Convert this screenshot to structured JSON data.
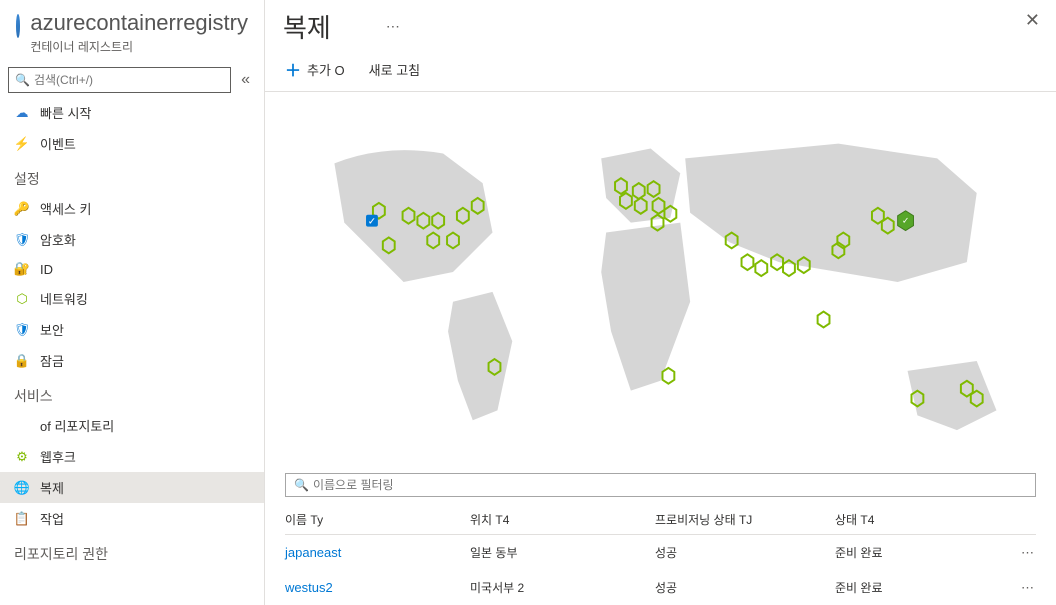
{
  "header": {
    "registry_name": "azurecontainerregistry",
    "separator": " | ",
    "page_title": "복제",
    "subtitle": "컨테이너 레지스트리"
  },
  "sidebar": {
    "search_placeholder": "검색(Ctrl+/)",
    "items": [
      {
        "label": "빠른 시작",
        "icon": "📘",
        "color": "#2f7cd0"
      },
      {
        "label": "이벤트",
        "icon": "⚡",
        "color": "#f2c811"
      }
    ],
    "section_settings": "설정",
    "settings_items": [
      {
        "label": "액세스 키",
        "icon": "🔑",
        "color": "#e8a33d"
      },
      {
        "label": "암호화",
        "icon": "🛡️",
        "color": "#0078d4"
      },
      {
        "label": "ID",
        "icon": "🔐",
        "color": "#e8a33d"
      },
      {
        "label": "네트워킹",
        "icon": "🌐",
        "color": "#7fba00"
      },
      {
        "label": "보안",
        "icon": "🛡️",
        "color": "#0078d4"
      },
      {
        "label": "잠금",
        "icon": "🔒",
        "color": "#0078d4"
      }
    ],
    "section_services": "서비스",
    "service_items": [
      {
        "label": "of 리포지토리",
        "icon": "",
        "color": ""
      },
      {
        "label": "웹후크",
        "icon": "⚙️",
        "color": "#7fba00"
      },
      {
        "label": "복제",
        "icon": "🌍",
        "color": "#0078d4",
        "selected": true
      },
      {
        "label": "작업",
        "icon": "📋",
        "color": "#e8a33d"
      }
    ],
    "section_repo_perm": "리포지토리 권한"
  },
  "toolbar": {
    "add_label": "추가 O",
    "refresh_label": "새로 고침"
  },
  "filter": {
    "placeholder": "이름으로 필터링"
  },
  "table": {
    "columns": {
      "name": "이름 Ty",
      "location": "위치 T4",
      "provisioning": "프로비저닝 상태 TJ",
      "status": "상태 T4"
    },
    "rows": [
      {
        "name": "japaneast",
        "location": "일본 동부",
        "provisioning": "성공",
        "status": "준비 완료"
      },
      {
        "name": "westus2",
        "location": "미국서부 2",
        "provisioning": "성공",
        "status": "준비 완료"
      }
    ]
  }
}
